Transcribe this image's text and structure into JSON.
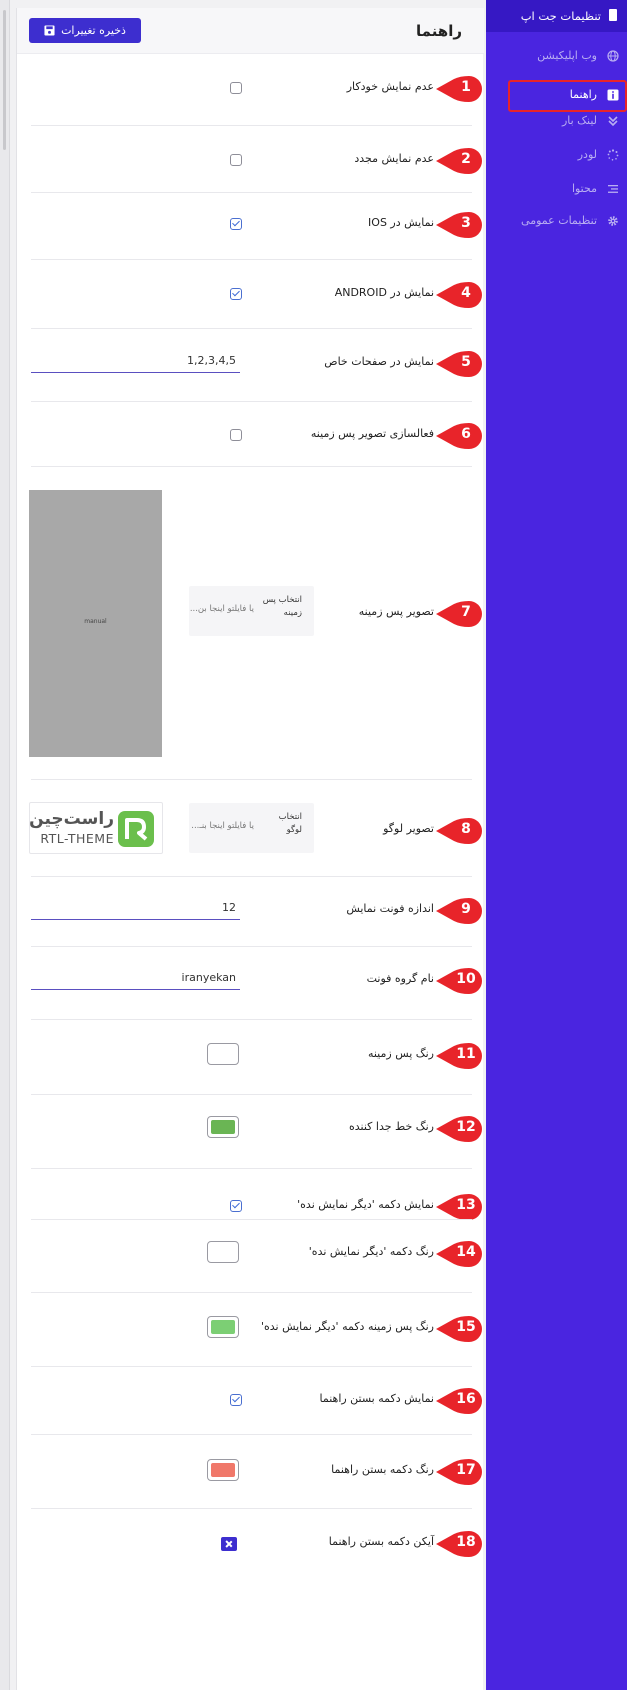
{
  "header": {
    "title": "راهنما",
    "save_label": "ذخیره تغییرات"
  },
  "sidebar": {
    "title": "تنظیمات جت اپ",
    "items": [
      {
        "label": "وب اپلیکیشن",
        "icon": "globe-icon"
      },
      {
        "label": "راهنما",
        "icon": "info-icon",
        "active": true
      },
      {
        "label": "لینک بار",
        "icon": "chevrons-down-icon"
      },
      {
        "label": "لودر",
        "icon": "spinner-icon"
      },
      {
        "label": "محتوا",
        "icon": "align-right-icon"
      },
      {
        "label": "تنظیمات عمومی",
        "icon": "gear-icon"
      }
    ]
  },
  "settings": [
    {
      "num": "1",
      "label": "عدم نمایش خودکار",
      "control": "checkbox",
      "checked": false
    },
    {
      "num": "2",
      "label": "عدم نمایش مجدد",
      "control": "checkbox",
      "checked": false
    },
    {
      "num": "3",
      "label": "نمایش در IOS",
      "control": "checkbox",
      "checked": true
    },
    {
      "num": "4",
      "label": "نمایش در ANDROID",
      "control": "checkbox",
      "checked": true
    },
    {
      "num": "5",
      "label": "نمایش در صفحات خاص",
      "control": "text",
      "value": "1,2,3,4,5"
    },
    {
      "num": "6",
      "label": "فعالسازی تصویر پس زمینه",
      "control": "checkbox",
      "checked": false
    },
    {
      "num": "7",
      "label": "تصویر پس زمینه",
      "control": "upload",
      "pick": "انتخاب پس زمینه",
      "drop": "یا فایلتو اینجا بن...",
      "preview_text": "manual"
    },
    {
      "num": "8",
      "label": "تصویر لوگو",
      "control": "upload",
      "pick": "انتخاب لوگو",
      "drop": "یا فایلتو اینجا بنـ...",
      "logo_fa": "راست‌چین",
      "logo_en": "RTL-THEME"
    },
    {
      "num": "9",
      "label": "اندازه فونت نمایش",
      "control": "text",
      "value": "12"
    },
    {
      "num": "10",
      "label": "نام گروه فونت",
      "control": "text",
      "value": "iranyekan"
    },
    {
      "num": "11",
      "label": "رنگ پس زمینه",
      "control": "color",
      "color": "#ffffff"
    },
    {
      "num": "12",
      "label": "رنگ خط جدا کننده",
      "control": "color",
      "color": "#6ab554"
    },
    {
      "num": "13",
      "label": "نمایش دکمه 'دیگر نمایش نده'",
      "control": "checkbox",
      "checked": true
    },
    {
      "num": "14",
      "label": "رنگ دکمه 'دیگر نمایش نده'",
      "control": "color",
      "color": "#ffffff"
    },
    {
      "num": "15",
      "label": "رنگ پس زمینه دکمه 'دیگر نمایش نده'",
      "control": "color",
      "color": "#7ccf74"
    },
    {
      "num": "16",
      "label": "نمایش دکمه بستن راهنما",
      "control": "checkbox",
      "checked": true
    },
    {
      "num": "17",
      "label": "رنگ دکمه بستن راهنما",
      "control": "color",
      "color": "#f0786a"
    },
    {
      "num": "18",
      "label": "آیکن دکمه بستن راهنما",
      "control": "icon",
      "icon": "close-icon"
    }
  ],
  "colors": {
    "accent": "#3d2ecf",
    "sidebar_bg": "#4a25e0",
    "badge": "#e8242a"
  }
}
